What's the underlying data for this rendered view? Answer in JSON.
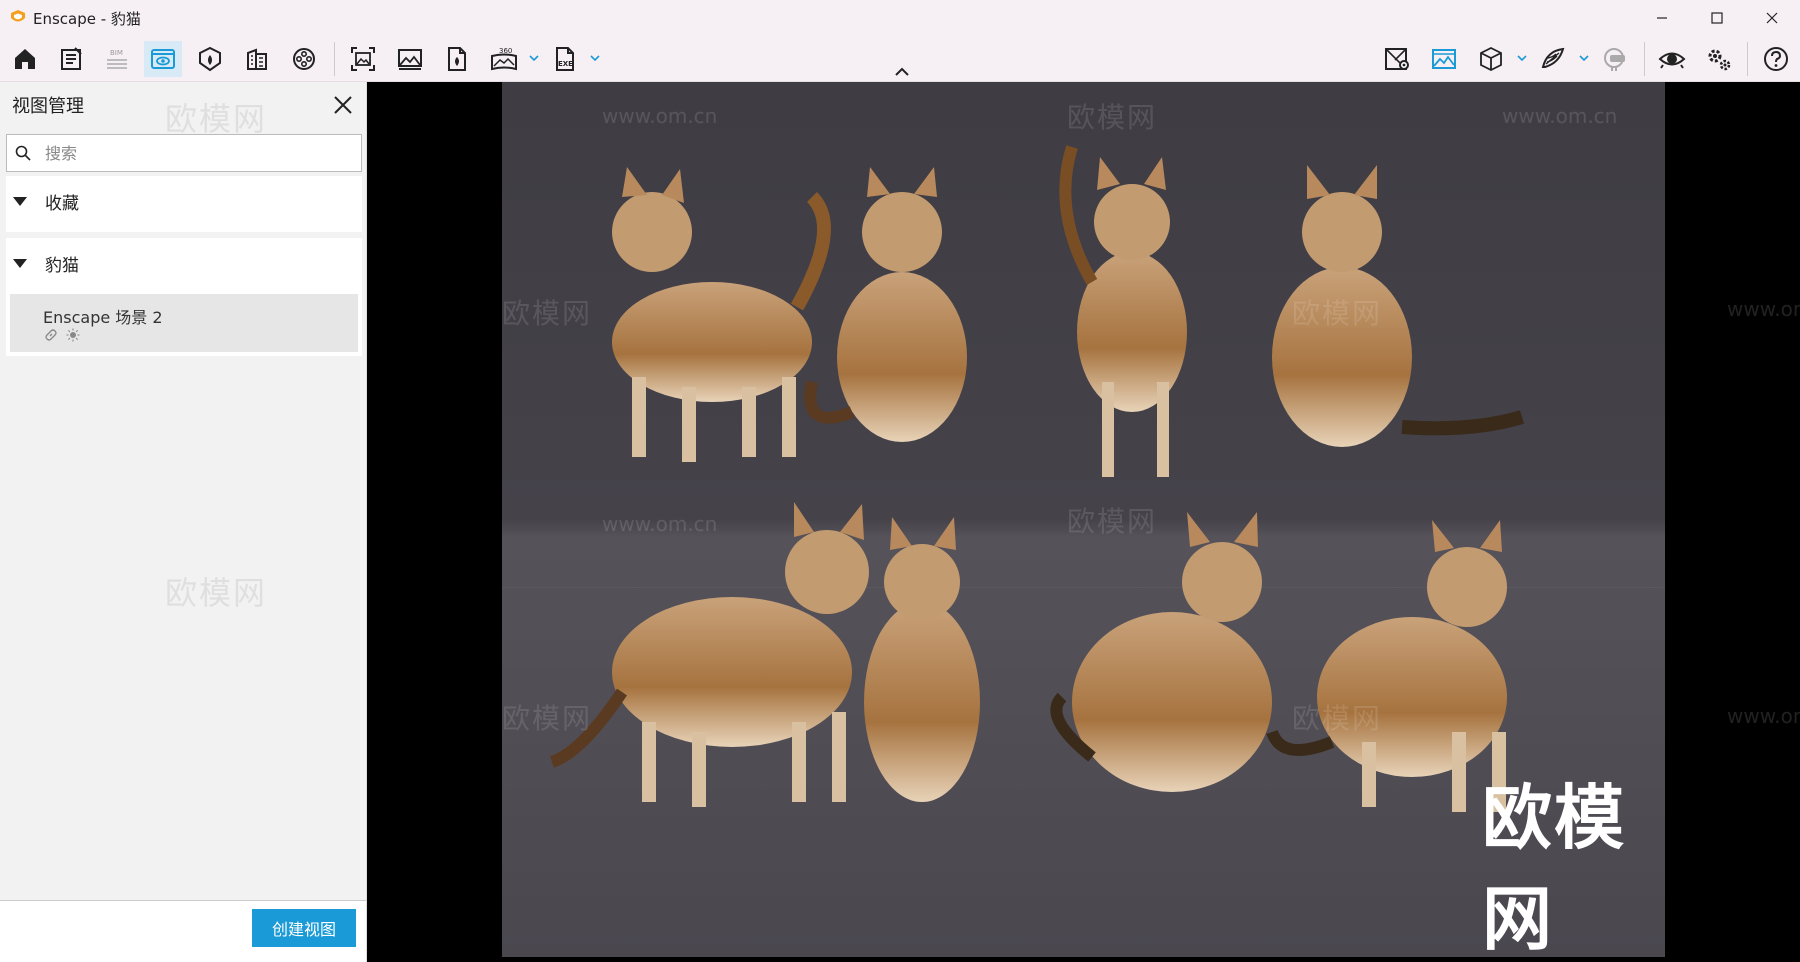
{
  "window": {
    "title": "Enscape - 豹猫",
    "minimize_icon": "minimize-icon",
    "maximize_icon": "maximize-icon",
    "close_icon": "close-icon"
  },
  "toolbar": {
    "left_icons": [
      "home-icon",
      "project-info-icon",
      "bim-icon",
      "views-icon",
      "atmosphere-icon",
      "asset-library-icon",
      "video-editor-icon",
      "batch-render-icon",
      "screenshot-icon",
      "export-file-icon",
      "panorama-360-icon",
      "exe-export-icon"
    ],
    "right_icons": [
      "map-icon",
      "visual-settings-icon",
      "cube-icon",
      "material-icon",
      "vr-headset-icon",
      "visibility-icon",
      "settings-icon",
      "help-icon"
    ],
    "bim_label": "BIM",
    "panorama_label": "360",
    "exe_label": "EXE",
    "active_color": "#1a9ad6"
  },
  "sidebar": {
    "title": "视图管理",
    "search_placeholder": "搜索",
    "groups": [
      {
        "label": "收藏"
      },
      {
        "label": "豹猫",
        "items": [
          {
            "name": "Enscape 场景 2",
            "icons": [
              "link-icon",
              "sun-icon"
            ]
          }
        ]
      }
    ],
    "create_button": "创建视图",
    "watermark": "欧模网"
  },
  "viewport": {
    "watermark_cn": "欧模网",
    "watermark_url": "www.om.cn",
    "brand_mark": "欧模网",
    "scene_description": "eight bengal cats"
  },
  "colors": {
    "accent": "#1a9ad6",
    "titlebar_bg": "#f6f0f4",
    "viewport_bg": "#000000"
  }
}
